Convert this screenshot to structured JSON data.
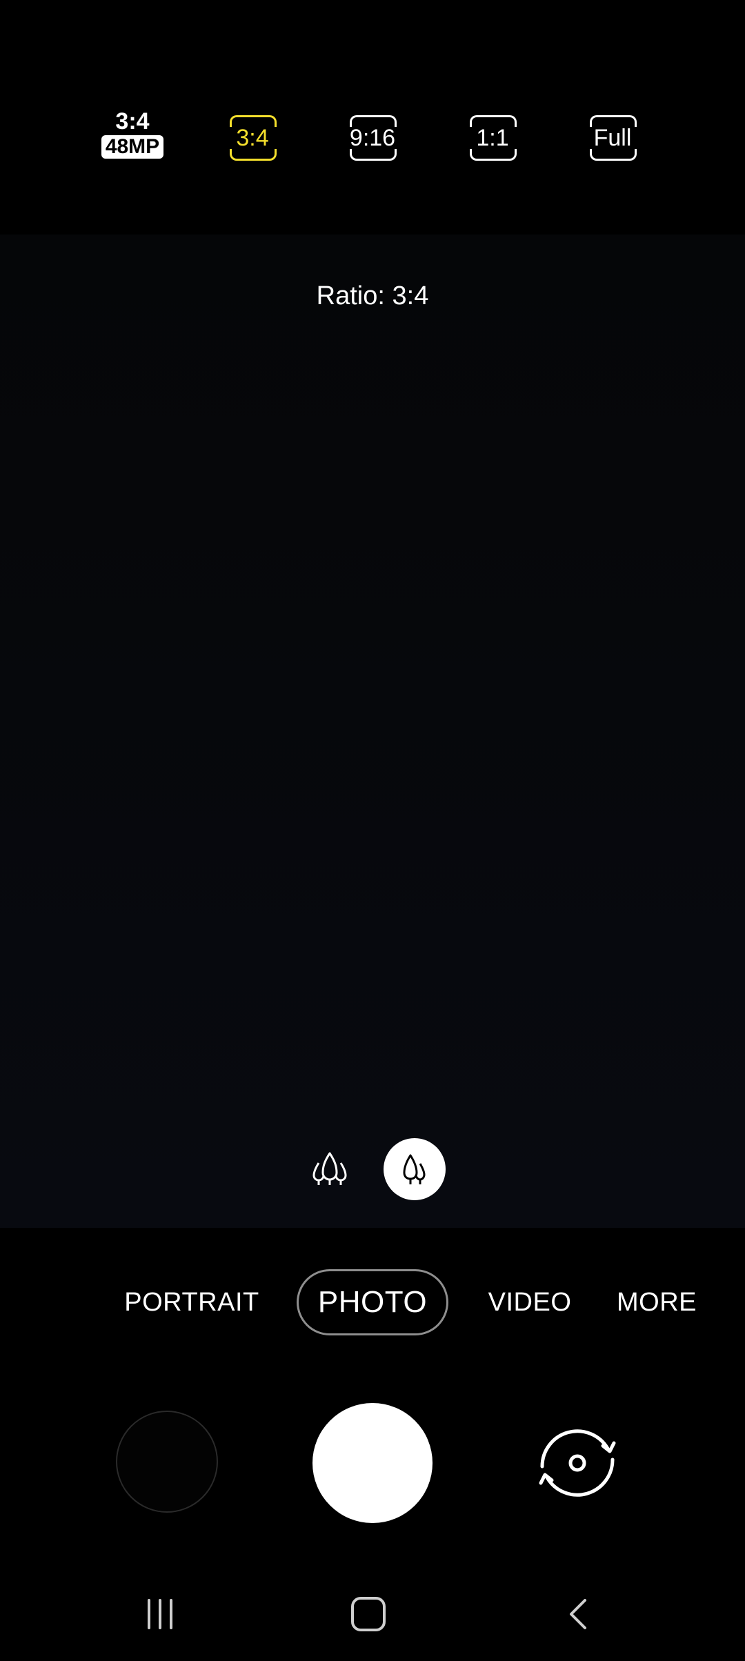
{
  "ratio_options": [
    {
      "label": "3:4",
      "badge": "48MP"
    },
    {
      "label": "3:4",
      "selected": true
    },
    {
      "label": "9:16"
    },
    {
      "label": "1:1"
    },
    {
      "label": "Full"
    }
  ],
  "toast": "Ratio: 3:4",
  "lens": {
    "wide_icon": "ultra-wide-trees-icon",
    "main_icon": "wide-tree-icon"
  },
  "modes": [
    "PORTRAIT",
    "PHOTO",
    "VIDEO",
    "MORE"
  ],
  "selected_mode": "PHOTO",
  "controls": {
    "gallery_icon": "gallery-thumbnail",
    "shutter_icon": "shutter-button",
    "switch_icon": "switch-camera-icon"
  },
  "nav": {
    "recents_icon": "recents-icon",
    "home_icon": "home-icon",
    "back_icon": "back-icon"
  },
  "colors": {
    "accent_selected": "#f4df2c",
    "background": "#000000",
    "mode_pill_border": "#8e8e8e"
  }
}
